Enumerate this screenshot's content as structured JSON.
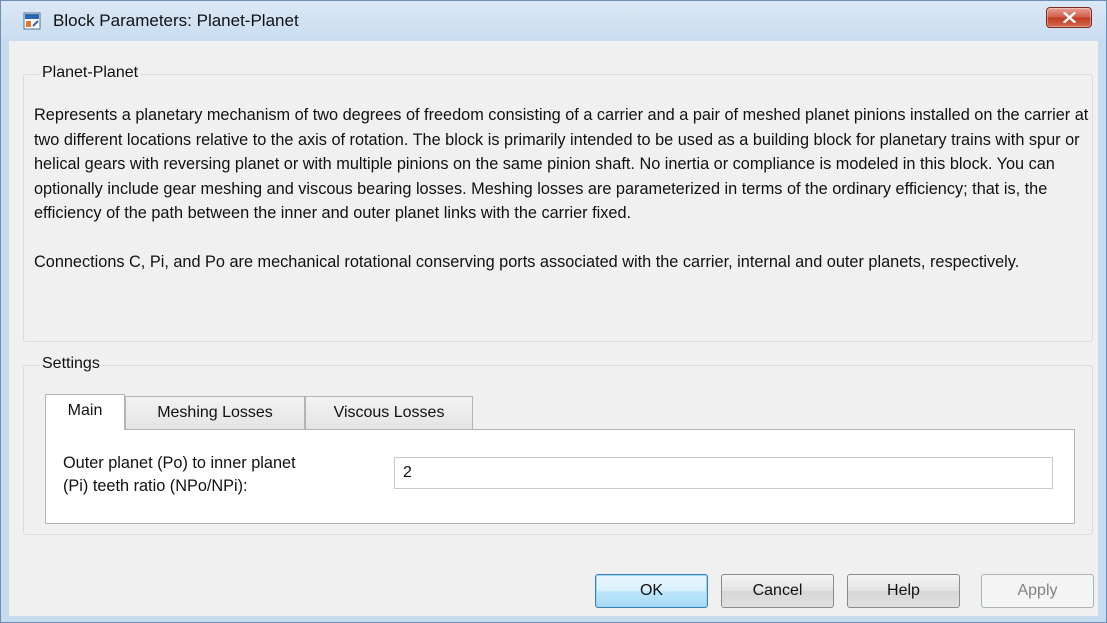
{
  "window": {
    "title": "Block Parameters: Planet-Planet"
  },
  "description_group": {
    "label": "Planet-Planet",
    "paragraphs": [
      "Represents a planetary mechanism of two degrees of freedom consisting of a carrier and a pair of meshed planet pinions installed on the carrier at two different locations relative to the axis of rotation. The block is primarily intended to be used as a building block for planetary trains with spur or helical gears with reversing planet or with multiple pinions on the same pinion shaft. No inertia or compliance is modeled in this block. You can optionally include gear meshing and viscous bearing losses. Meshing losses are parameterized in terms of the ordinary efficiency; that is,  the efficiency of the path between the inner and outer planet links with the carrier fixed.",
      "Connections C, Pi, and Po are mechanical rotational conserving ports associated with the carrier, internal and outer planets, respectively."
    ]
  },
  "settings_group": {
    "label": "Settings",
    "tabs": [
      {
        "label": "Main",
        "active": true
      },
      {
        "label": "Meshing Losses",
        "active": false
      },
      {
        "label": "Viscous Losses",
        "active": false
      }
    ],
    "param": {
      "label_line1": "Outer planet (Po) to inner planet",
      "label_line2": "(Pi) teeth ratio (NPo/NPi):",
      "value": "2"
    }
  },
  "buttons": {
    "ok": "OK",
    "cancel": "Cancel",
    "help": "Help",
    "apply": "Apply"
  },
  "icons": {
    "title": "simulink-block-icon",
    "close": "close-icon"
  },
  "colors": {
    "close_button": "#c9442d",
    "default_button_border": "#3c7fb1",
    "window_frame": "#c7dbef"
  }
}
